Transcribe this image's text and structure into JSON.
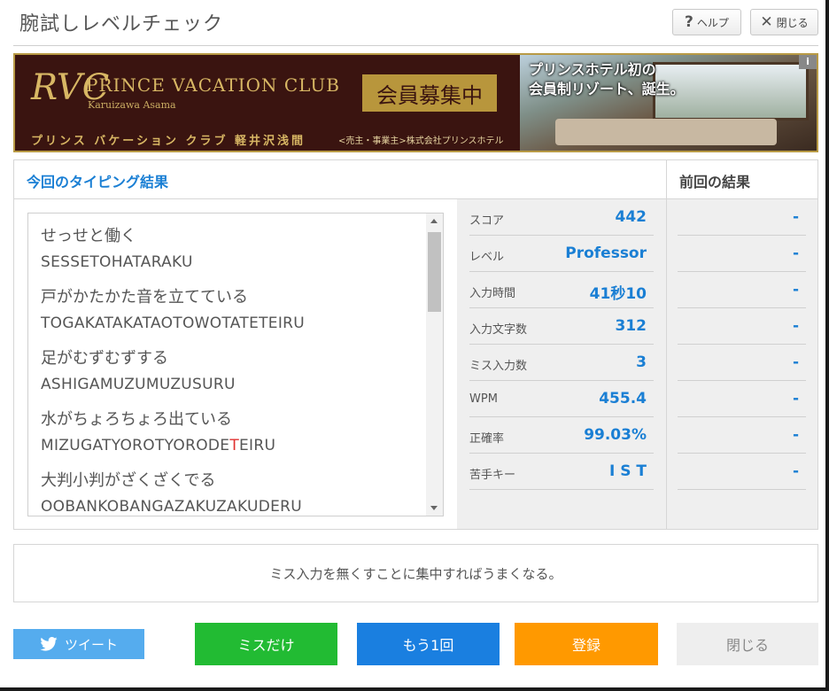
{
  "dialog": {
    "title": "腕試しレベルチェック",
    "help_label": "ヘルプ",
    "close_label": "閉じる"
  },
  "banner": {
    "logo": "RVC",
    "club_name": "PRINCE VACATION CLUB",
    "location": "Karuizawa Asama",
    "jp_name": "プリンス バケーション クラブ 軽井沢浅間",
    "badge": "会員募集中",
    "company": "<売主・事業主>株式会社プリンスホテル",
    "catch_line1": "プリンスホテル初の",
    "catch_line2": "会員制リゾート、誕生。",
    "info": "i"
  },
  "results": {
    "current_header": "今回のタイピング結果",
    "previous_header": "前回の結果",
    "phrases": [
      {
        "jp": "せっせと働く",
        "romaji": "SESSETOHATARAKU"
      },
      {
        "jp": "戸がかたかた音を立てている",
        "romaji": "TOGAKATAKATAOTOWOTATETEIRU"
      },
      {
        "jp": "足がむずむずする",
        "romaji": "ASHIGAMUZUMUZUSURU"
      },
      {
        "jp": "水がちょろちょろ出ている",
        "romaji_pre": "MIZUGATYOROTYORODE",
        "romaji_miss": "T",
        "romaji_post": "EIRU"
      },
      {
        "jp": "大判小判がざくざくでる",
        "romaji": "OOBANKOBANGAZAKUZAKUDERU"
      }
    ],
    "stats": [
      {
        "label": "スコア",
        "value": "442",
        "prev": "-"
      },
      {
        "label": "レベル",
        "value": "Professor",
        "prev": "-"
      },
      {
        "label": "入力時間",
        "value": "41秒10",
        "prev": "-"
      },
      {
        "label": "入力文字数",
        "value": "312",
        "prev": "-"
      },
      {
        "label": "ミス入力数",
        "value": "3",
        "prev": "-"
      },
      {
        "label": "WPM",
        "value": "455.4",
        "prev": "-"
      },
      {
        "label": "正確率",
        "value": "99.03%",
        "prev": "-"
      },
      {
        "label": "苦手キー",
        "value": "I S T",
        "prev": "-"
      }
    ]
  },
  "advice": "ミス入力を無くすことに集中すればうまくなる。",
  "buttons": {
    "tweet": "ツイート",
    "miss_only": "ミスだけ",
    "retry": "もう1回",
    "register": "登録",
    "close": "閉じる"
  },
  "colors": {
    "accent_blue": "#1a7fd4",
    "miss_red": "#e0302f",
    "green": "#22bb33",
    "orange": "#ff9900",
    "twitter": "#55acee"
  }
}
